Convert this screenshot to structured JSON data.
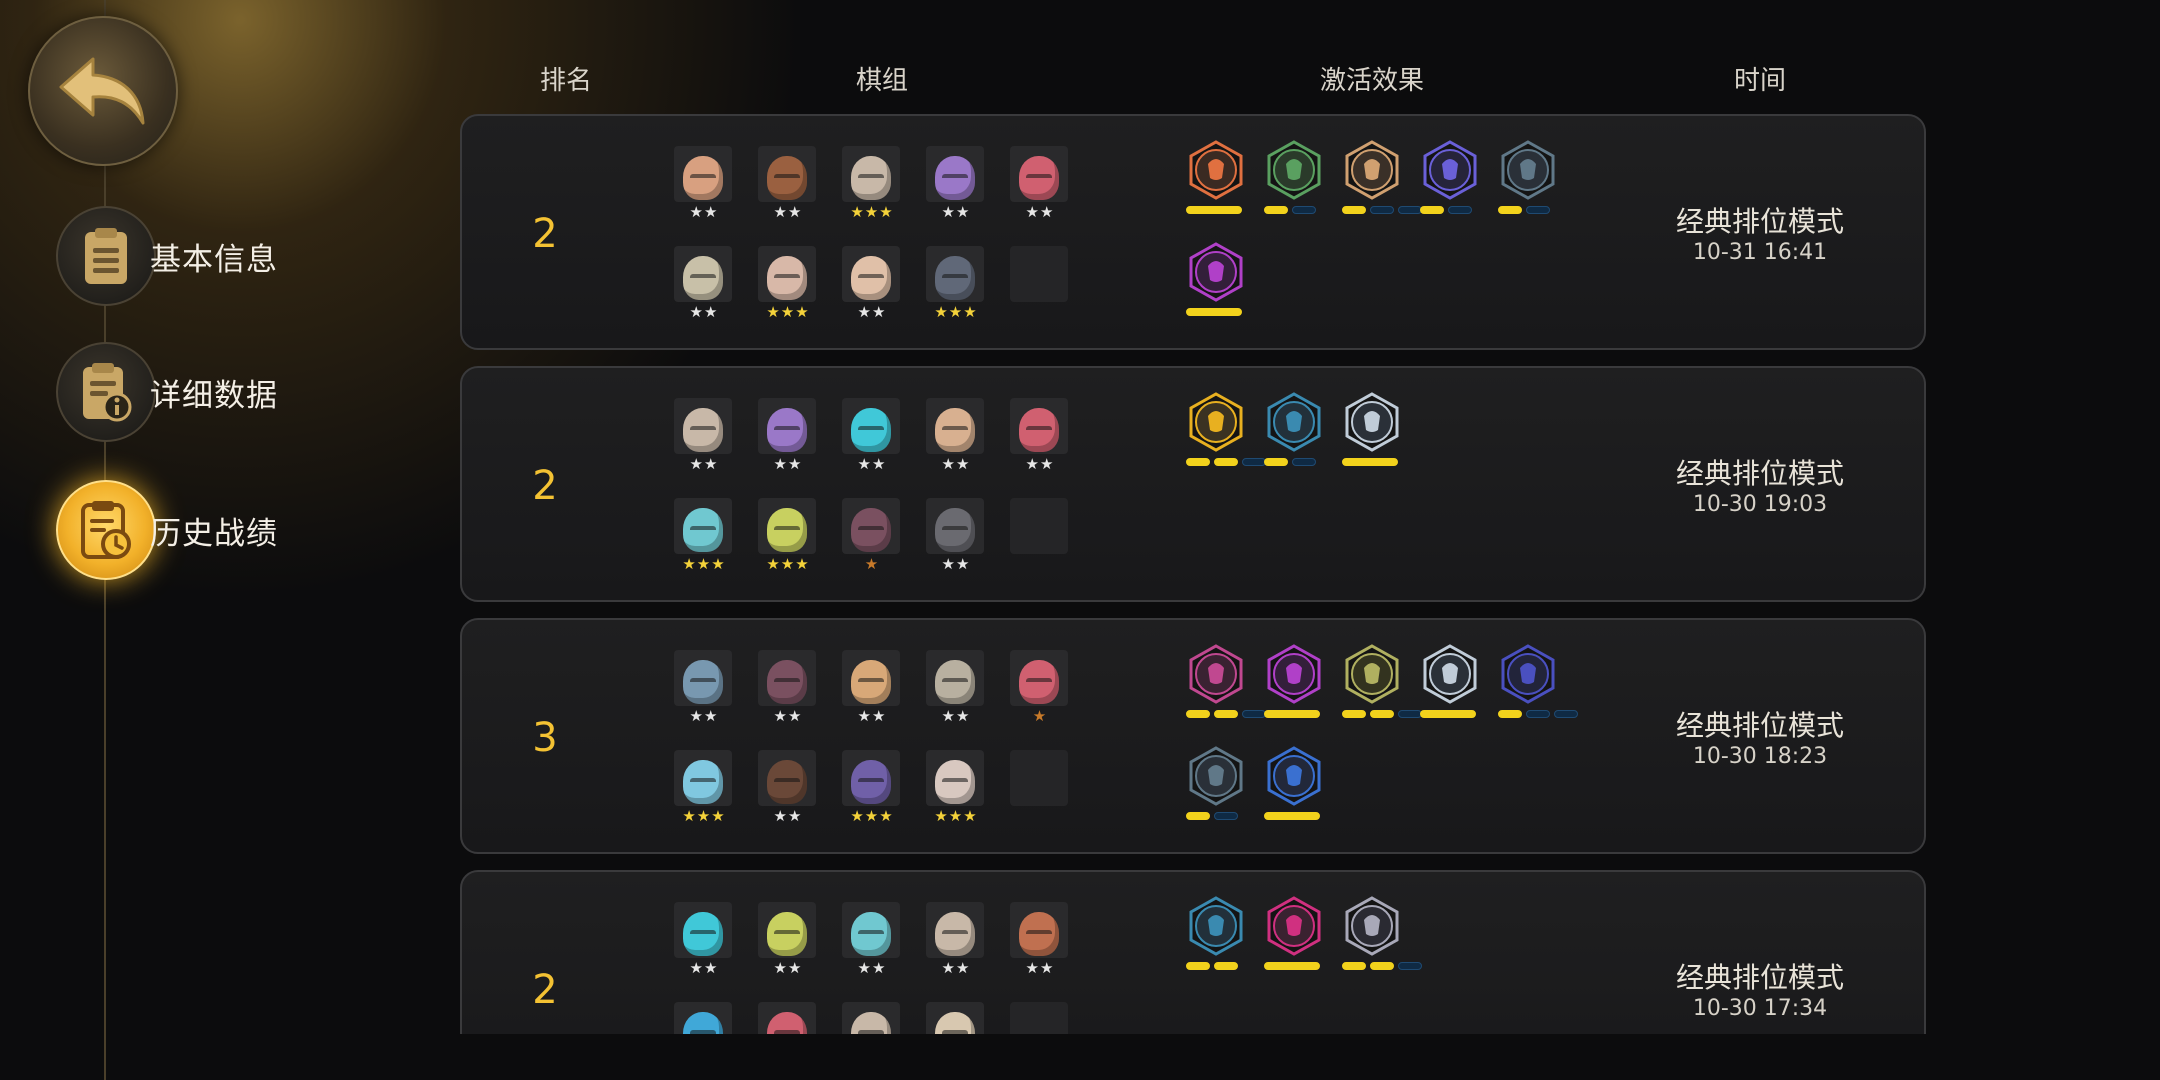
{
  "nav": {
    "back_icon": "back-arrow-icon",
    "items": [
      {
        "label": "基本信息",
        "icon": "document-icon",
        "active": false
      },
      {
        "label": "详细数据",
        "icon": "info-document-icon",
        "active": false
      },
      {
        "label": "历史战绩",
        "icon": "history-icon",
        "active": true
      }
    ]
  },
  "headers": {
    "rank": "排名",
    "chess": "棋组",
    "synergy": "激活效果",
    "time": "时间"
  },
  "colors": {
    "accent": "#f4c233",
    "bar_on": "#f2d21c",
    "bar_off": "#0f2a44"
  },
  "records": [
    {
      "rank": "2",
      "mode": "经典排位模式",
      "time": "10-31 16:41",
      "pieces": [
        {
          "color": "#d8a080",
          "stars": "★★",
          "tier": "silver"
        },
        {
          "color": "#9a6040",
          "stars": "★★",
          "tier": "silver"
        },
        {
          "color": "#c8b8a8",
          "stars": "★★★",
          "tier": "gold"
        },
        {
          "color": "#9a78c8",
          "stars": "★★",
          "tier": "silver"
        },
        {
          "color": "#d06070",
          "stars": "★★",
          "tier": "silver"
        },
        {
          "color": "#c8c0a8",
          "stars": "★★",
          "tier": "silver"
        },
        {
          "color": "#d8b8a8",
          "stars": "★★★",
          "tier": "gold"
        },
        {
          "color": "#e0c0a8",
          "stars": "★★",
          "tier": "silver"
        },
        {
          "color": "#606878",
          "stars": "★★★",
          "tier": "gold"
        },
        {
          "color": "",
          "stars": "",
          "tier": "empty"
        }
      ],
      "synergies": [
        {
          "icon": "helmet-icon",
          "color": "#e07040",
          "ring": "#3a2a22",
          "segs": [
            1
          ]
        },
        {
          "icon": "bow-icon",
          "color": "#5aa060",
          "ring": "#2a3a2a",
          "segs": [
            1,
            0
          ]
        },
        {
          "icon": "axe-icon",
          "color": "#d0a070",
          "ring": "#3a3028",
          "segs": [
            1,
            0,
            0
          ]
        },
        {
          "icon": "fish-bone-icon",
          "color": "#6a60d8",
          "ring": "#26243a",
          "segs": [
            1,
            0
          ]
        },
        {
          "icon": "tribal-icon",
          "color": "#607888",
          "ring": "#2a3038",
          "segs": [
            1,
            0
          ]
        },
        {
          "icon": "demon-icon",
          "color": "#b040c8",
          "ring": "#331f3a",
          "segs": [
            1
          ]
        }
      ]
    },
    {
      "rank": "2",
      "mode": "经典排位模式",
      "time": "10-30 19:03",
      "pieces": [
        {
          "color": "#c8b8a8",
          "stars": "★★",
          "tier": "silver"
        },
        {
          "color": "#9a78c8",
          "stars": "★★",
          "tier": "silver"
        },
        {
          "color": "#40c8d8",
          "stars": "★★",
          "tier": "silver"
        },
        {
          "color": "#d8b090",
          "stars": "★★",
          "tier": "silver"
        },
        {
          "color": "#d06070",
          "stars": "★★",
          "tier": "silver"
        },
        {
          "color": "#70c8d0",
          "stars": "★★★",
          "tier": "gold"
        },
        {
          "color": "#c8d060",
          "stars": "★★★",
          "tier": "gold"
        },
        {
          "color": "#7a5060",
          "stars": "★",
          "tier": "bronze"
        },
        {
          "color": "#6a6a70",
          "stars": "★★",
          "tier": "silver"
        },
        {
          "color": "",
          "stars": "",
          "tier": "empty"
        }
      ],
      "synergies": [
        {
          "icon": "swirl-icon",
          "color": "#e8b020",
          "ring": "#3a3222",
          "segs": [
            1,
            1,
            0
          ]
        },
        {
          "icon": "question-mark-icon",
          "color": "#3a8ab0",
          "ring": "#22303a",
          "segs": [
            1,
            0
          ]
        },
        {
          "icon": "cross-icon",
          "color": "#c0ccd8",
          "ring": "#2a3038",
          "segs": [
            1
          ]
        }
      ]
    },
    {
      "rank": "3",
      "mode": "经典排位模式",
      "time": "10-30 18:23",
      "pieces": [
        {
          "color": "#7898b0",
          "stars": "★★",
          "tier": "silver"
        },
        {
          "color": "#7a5060",
          "stars": "★★",
          "tier": "silver"
        },
        {
          "color": "#d8a878",
          "stars": "★★",
          "tier": "silver"
        },
        {
          "color": "#b8b0a0",
          "stars": "★★",
          "tier": "silver"
        },
        {
          "color": "#d06070",
          "stars": "★",
          "tier": "bronze"
        },
        {
          "color": "#80c8e0",
          "stars": "★★★",
          "tier": "gold"
        },
        {
          "color": "#6a4838",
          "stars": "★★",
          "tier": "silver"
        },
        {
          "color": "#7060a8",
          "stars": "★★★",
          "tier": "gold"
        },
        {
          "color": "#d8c8c0",
          "stars": "★★★",
          "tier": "gold"
        },
        {
          "color": "",
          "stars": "",
          "tier": "empty"
        }
      ],
      "synergies": [
        {
          "icon": "knight-icon",
          "color": "#c04890",
          "ring": "#3a2232",
          "segs": [
            1,
            1,
            0
          ]
        },
        {
          "icon": "demon-icon",
          "color": "#b040c8",
          "ring": "#331f3a",
          "segs": [
            1
          ]
        },
        {
          "icon": "beast-icon",
          "color": "#b0b060",
          "ring": "#33331f",
          "segs": [
            1,
            1,
            0
          ]
        },
        {
          "icon": "cross-icon",
          "color": "#c0ccd8",
          "ring": "#2a3038",
          "segs": [
            1
          ]
        },
        {
          "icon": "mech-icon",
          "color": "#4a50c0",
          "ring": "#22243a",
          "segs": [
            1,
            0,
            0
          ]
        },
        {
          "icon": "tribal-icon",
          "color": "#607888",
          "ring": "#2a3038",
          "segs": [
            1,
            0
          ]
        },
        {
          "icon": "shatter-icon",
          "color": "#3a70d0",
          "ring": "#22283a",
          "segs": [
            1
          ]
        }
      ]
    },
    {
      "rank": "2",
      "mode": "经典排位模式",
      "time": "10-30 17:34",
      "pieces": [
        {
          "color": "#40c8d8",
          "stars": "★★",
          "tier": "silver"
        },
        {
          "color": "#c8d060",
          "stars": "★★",
          "tier": "silver"
        },
        {
          "color": "#70c8d0",
          "stars": "★★",
          "tier": "silver"
        },
        {
          "color": "#c8b8a8",
          "stars": "★★",
          "tier": "silver"
        },
        {
          "color": "#c07050",
          "stars": "★★",
          "tier": "silver"
        },
        {
          "color": "#40a8d8",
          "stars": "",
          "tier": "silver"
        },
        {
          "color": "#d06070",
          "stars": "",
          "tier": "silver"
        },
        {
          "color": "#c8b8a8",
          "stars": "",
          "tier": "silver"
        },
        {
          "color": "#d8c8b0",
          "stars": "",
          "tier": "silver"
        },
        {
          "color": "",
          "stars": "",
          "tier": "empty"
        }
      ],
      "synergies": [
        {
          "icon": "question-mark-icon",
          "color": "#3a8ab0",
          "ring": "#22303a",
          "segs": [
            1,
            1
          ]
        },
        {
          "icon": "bat-icon",
          "color": "#d03080",
          "ring": "#3a2230",
          "segs": [
            1
          ]
        },
        {
          "icon": "pawn-icon",
          "color": "#a8a8b8",
          "ring": "#2a2a32",
          "segs": [
            1,
            1,
            0
          ]
        }
      ]
    }
  ]
}
